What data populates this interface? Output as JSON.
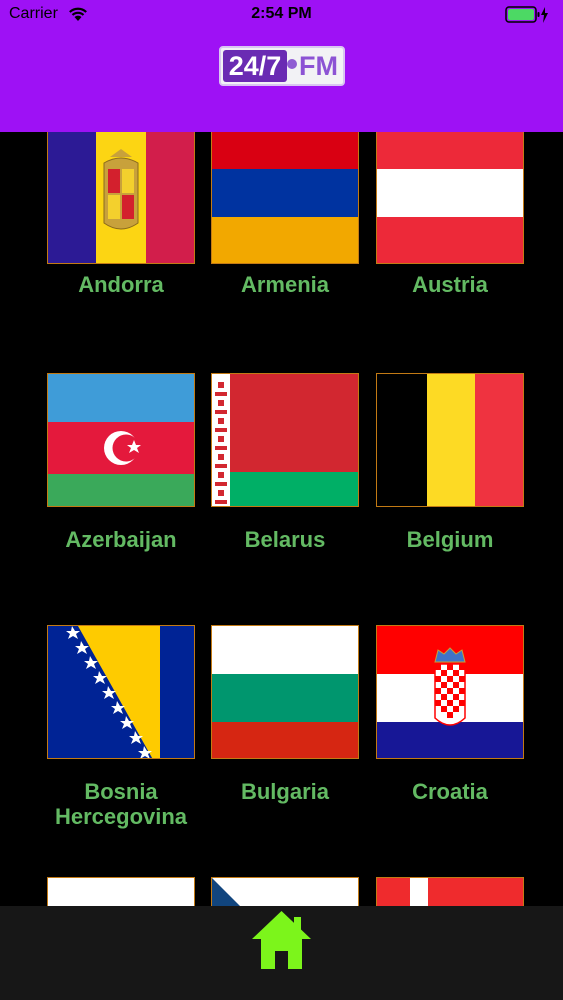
{
  "status_bar": {
    "carrier": "Carrier",
    "time": "2:54 PM"
  },
  "app": {
    "logo_left": "24/7",
    "logo_right": "FM",
    "accent_color": "#9e11f5"
  },
  "countries": [
    {
      "name": "Andorra"
    },
    {
      "name": "Armenia"
    },
    {
      "name": "Austria"
    },
    {
      "name": "Azerbaijan"
    },
    {
      "name": "Belarus"
    },
    {
      "name": "Belgium"
    },
    {
      "name": "Bosnia Hercegovina"
    },
    {
      "name": "Bulgaria"
    },
    {
      "name": "Croatia"
    },
    {
      "name": ""
    },
    {
      "name": ""
    },
    {
      "name": ""
    }
  ],
  "bottom_nav": {
    "home_icon": "home-icon",
    "icon_color": "#7cf51b"
  }
}
